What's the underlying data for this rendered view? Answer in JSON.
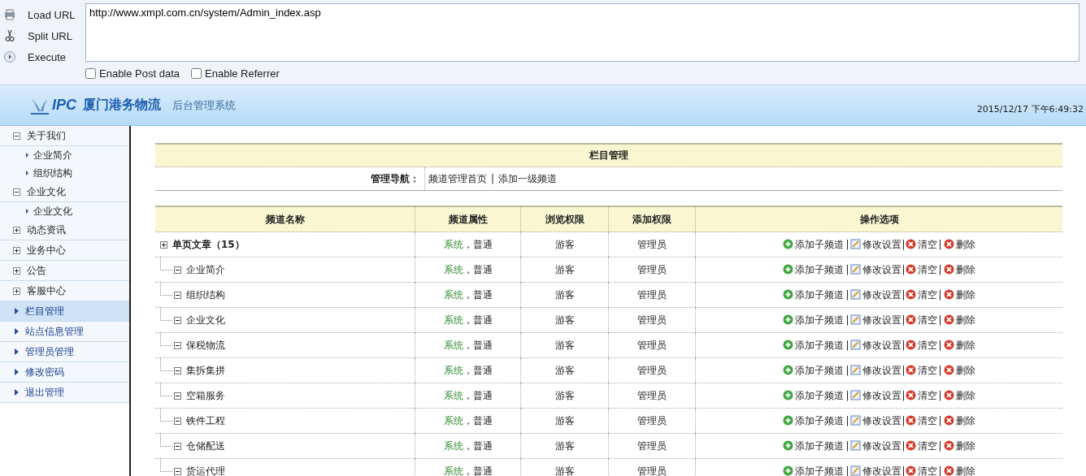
{
  "toolbar": {
    "buttons": [
      {
        "kind": "load",
        "label": "Load URL"
      },
      {
        "kind": "split",
        "label": "Split URL"
      },
      {
        "kind": "execute",
        "label": "Execute"
      }
    ],
    "url": "http://www.xmpl.com.cn/system/Admin_index.asp",
    "options": [
      {
        "label": "Enable Post data",
        "checked": false
      },
      {
        "label": "Enable Referrer",
        "checked": false
      }
    ]
  },
  "header": {
    "logo": "IPC",
    "company": "厦门港务物流",
    "system": "后台管理系统",
    "datetime": "2015/12/17 下午6:49:32"
  },
  "sidebar": {
    "items": [
      {
        "kind": "group",
        "label": "关于我们",
        "expanded": true,
        "selected": false,
        "children": [
          {
            "label": "企业简介",
            "selected": false
          },
          {
            "label": "组织结构",
            "selected": false
          }
        ]
      },
      {
        "kind": "group",
        "label": "企业文化",
        "expanded": true,
        "selected": false,
        "children": [
          {
            "label": "企业文化",
            "selected": false
          }
        ]
      },
      {
        "kind": "group",
        "label": "动态资讯",
        "expanded": false,
        "selected": false
      },
      {
        "kind": "group",
        "label": "业务中心",
        "expanded": false,
        "selected": false
      },
      {
        "kind": "group",
        "label": "公告",
        "expanded": false,
        "selected": false
      },
      {
        "kind": "group",
        "label": "客服中心",
        "expanded": false,
        "selected": false
      },
      {
        "kind": "link",
        "label": "栏目管理",
        "selected": true
      },
      {
        "kind": "link",
        "label": "站点信息管理",
        "selected": false
      },
      {
        "kind": "link",
        "label": "管理员管理",
        "selected": false
      },
      {
        "kind": "link",
        "label": "修改密码",
        "selected": false
      },
      {
        "kind": "link",
        "label": "退出管理",
        "selected": false
      }
    ]
  },
  "panel": {
    "title": "栏目管理",
    "nav_label": "管理导航：",
    "nav_links": [
      {
        "kind": "link",
        "label": "频道管理首页"
      },
      {
        "kind": "separator",
        "label": "|"
      },
      {
        "kind": "link",
        "label": "添加一级频道"
      }
    ]
  },
  "table": {
    "columns": [
      "频道名称",
      "频道属性",
      "浏览权限",
      "添加权限",
      "操作选项"
    ],
    "rows": [
      {
        "name": "单页文章（15）",
        "expanded": false,
        "system": "系统",
        "attribute": "，普通",
        "browse": "游客",
        "add": "管理员",
        "actions": [
          {
            "kind": "add",
            "label": "添加子频道"
          },
          {
            "kind": "separator",
            "label": "|"
          },
          {
            "kind": "edit",
            "label": "修改设置|"
          },
          {
            "kind": "clear",
            "label": "清空"
          },
          {
            "kind": "separator",
            "label": "|"
          },
          {
            "kind": "delete",
            "label": "删除"
          }
        ],
        "children": [
          {
            "name": "企业简介",
            "expanded": true,
            "system": "系统",
            "attribute": "，普通",
            "browse": "游客",
            "add": "管理员",
            "actions": [
              {
                "kind": "add",
                "label": "添加子频道"
              },
              {
                "kind": "separator",
                "label": "|"
              },
              {
                "kind": "edit",
                "label": "修改设置|"
              },
              {
                "kind": "clear",
                "label": "清空"
              },
              {
                "kind": "separator",
                "label": "|"
              },
              {
                "kind": "delete",
                "label": "删除"
              }
            ]
          },
          {
            "name": "组织结构",
            "expanded": true,
            "system": "系统",
            "attribute": "，普通",
            "browse": "游客",
            "add": "管理员",
            "actions": [
              {
                "kind": "add",
                "label": "添加子频道"
              },
              {
                "kind": "separator",
                "label": "|"
              },
              {
                "kind": "edit",
                "label": "修改设置|"
              },
              {
                "kind": "clear",
                "label": "清空"
              },
              {
                "kind": "separator",
                "label": "|"
              },
              {
                "kind": "delete",
                "label": "删除"
              }
            ]
          },
          {
            "name": "企业文化",
            "expanded": true,
            "system": "系统",
            "attribute": "，普通",
            "browse": "游客",
            "add": "管理员",
            "actions": [
              {
                "kind": "add",
                "label": "添加子频道"
              },
              {
                "kind": "separator",
                "label": "|"
              },
              {
                "kind": "edit",
                "label": "修改设置|"
              },
              {
                "kind": "clear",
                "label": "清空"
              },
              {
                "kind": "separator",
                "label": "|"
              },
              {
                "kind": "delete",
                "label": "删除"
              }
            ]
          },
          {
            "name": "保税物流",
            "expanded": true,
            "system": "系统",
            "attribute": "，普通",
            "browse": "游客",
            "add": "管理员",
            "actions": [
              {
                "kind": "add",
                "label": "添加子频道"
              },
              {
                "kind": "separator",
                "label": "|"
              },
              {
                "kind": "edit",
                "label": "修改设置|"
              },
              {
                "kind": "clear",
                "label": "清空"
              },
              {
                "kind": "separator",
                "label": "|"
              },
              {
                "kind": "delete",
                "label": "删除"
              }
            ]
          },
          {
            "name": "集拆集拼",
            "expanded": true,
            "system": "系统",
            "attribute": "，普通",
            "browse": "游客",
            "add": "管理员",
            "actions": [
              {
                "kind": "add",
                "label": "添加子频道"
              },
              {
                "kind": "separator",
                "label": "|"
              },
              {
                "kind": "edit",
                "label": "修改设置|"
              },
              {
                "kind": "clear",
                "label": "清空"
              },
              {
                "kind": "separator",
                "label": "|"
              },
              {
                "kind": "delete",
                "label": "删除"
              }
            ]
          },
          {
            "name": "空箱服务",
            "expanded": true,
            "system": "系统",
            "attribute": "，普通",
            "browse": "游客",
            "add": "管理员",
            "actions": [
              {
                "kind": "add",
                "label": "添加子频道"
              },
              {
                "kind": "separator",
                "label": "|"
              },
              {
                "kind": "edit",
                "label": "修改设置|"
              },
              {
                "kind": "clear",
                "label": "清空"
              },
              {
                "kind": "separator",
                "label": "|"
              },
              {
                "kind": "delete",
                "label": "删除"
              }
            ]
          },
          {
            "name": "铁件工程",
            "expanded": true,
            "system": "系统",
            "attribute": "，普通",
            "browse": "游客",
            "add": "管理员",
            "actions": [
              {
                "kind": "add",
                "label": "添加子频道"
              },
              {
                "kind": "separator",
                "label": "|"
              },
              {
                "kind": "edit",
                "label": "修改设置|"
              },
              {
                "kind": "clear",
                "label": "清空"
              },
              {
                "kind": "separator",
                "label": "|"
              },
              {
                "kind": "delete",
                "label": "删除"
              }
            ]
          },
          {
            "name": "仓储配送",
            "expanded": true,
            "system": "系统",
            "attribute": "，普通",
            "browse": "游客",
            "add": "管理员",
            "actions": [
              {
                "kind": "add",
                "label": "添加子频道"
              },
              {
                "kind": "separator",
                "label": "|"
              },
              {
                "kind": "edit",
                "label": "修改设置|"
              },
              {
                "kind": "clear",
                "label": "清空"
              },
              {
                "kind": "separator",
                "label": "|"
              },
              {
                "kind": "delete",
                "label": "删除"
              }
            ]
          },
          {
            "name": "货运代理",
            "expanded": true,
            "system": "系统",
            "attribute": "，普通",
            "browse": "游客",
            "add": "管理员",
            "actions": [
              {
                "kind": "add",
                "label": "添加子频道"
              },
              {
                "kind": "separator",
                "label": "|"
              },
              {
                "kind": "edit",
                "label": "修改设置|"
              },
              {
                "kind": "clear",
                "label": "清空"
              },
              {
                "kind": "separator",
                "label": "|"
              },
              {
                "kind": "delete",
                "label": "删除"
              }
            ]
          }
        ]
      }
    ]
  }
}
